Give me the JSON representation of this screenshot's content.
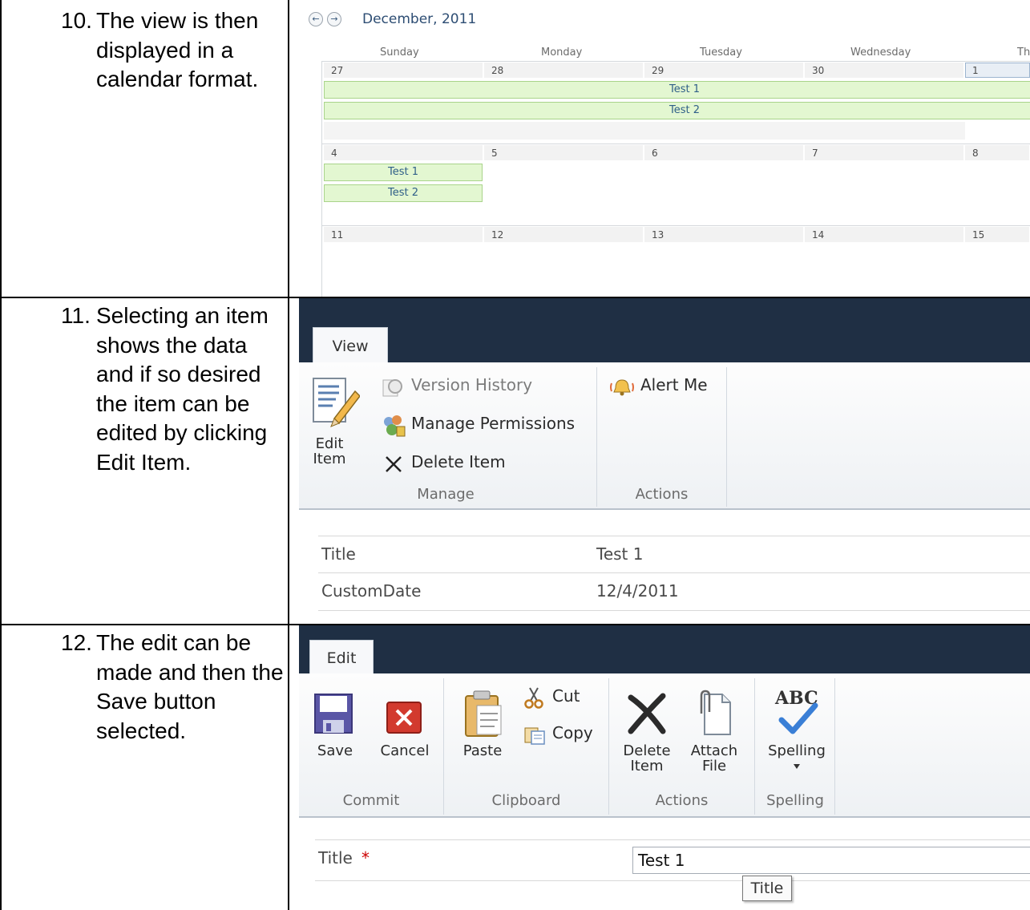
{
  "steps": [
    {
      "number": "10.",
      "text": "The view is then displayed in a calendar format."
    },
    {
      "number": "11.",
      "text": "Selecting an item shows the data and if so desired the item can be edited by clicking Edit Item."
    },
    {
      "number": "12.",
      "text": "The edit can be made and then the Save button selected."
    }
  ],
  "calendar": {
    "month_label": "December, 2011",
    "prev_icon": "left-arrow-icon",
    "next_icon": "right-arrow-icon",
    "day_names": [
      "Sunday",
      "Monday",
      "Tuesday",
      "Wednesday",
      "Th"
    ],
    "weeks": [
      {
        "days": [
          "27",
          "28",
          "29",
          "30",
          "1"
        ]
      },
      {
        "days": [
          "4",
          "5",
          "6",
          "7",
          "8"
        ]
      },
      {
        "days": [
          "11",
          "12",
          "13",
          "14",
          "15"
        ]
      }
    ],
    "events_week1": [
      "Test 1",
      "Test 2"
    ],
    "events_week2": [
      "Test 1",
      "Test 2"
    ]
  },
  "view_ribbon": {
    "tab_label": "View",
    "edit_item_label_1": "Edit",
    "edit_item_label_2": "Item",
    "version_history": "Version History",
    "manage_permissions": "Manage Permissions",
    "delete_item": "Delete Item",
    "alert_me": "Alert Me",
    "group_manage": "Manage",
    "group_actions": "Actions",
    "fields": [
      {
        "label": "Title",
        "value": "Test 1"
      },
      {
        "label": "CustomDate",
        "value": "12/4/2011"
      }
    ]
  },
  "edit_ribbon": {
    "tab_label": "Edit",
    "save": "Save",
    "cancel": "Cancel",
    "paste": "Paste",
    "cut": "Cut",
    "copy": "Copy",
    "delete_item_1": "Delete",
    "delete_item_2": "Item",
    "attach_file_1": "Attach",
    "attach_file_2": "File",
    "spelling": "Spelling",
    "spelling_icon_text": "ABC",
    "group_commit": "Commit",
    "group_clipboard": "Clipboard",
    "group_actions": "Actions",
    "group_spelling": "Spelling",
    "title_label": "Title",
    "required_mark": "*",
    "title_value": "Test 1",
    "tooltip": "Title"
  },
  "colors": {
    "ribbon_bar": "#1f2f44",
    "event_fill": "#e3f7d1",
    "event_border": "#a9d48a",
    "event_text": "#2f5f88",
    "required": "#cc0000"
  }
}
